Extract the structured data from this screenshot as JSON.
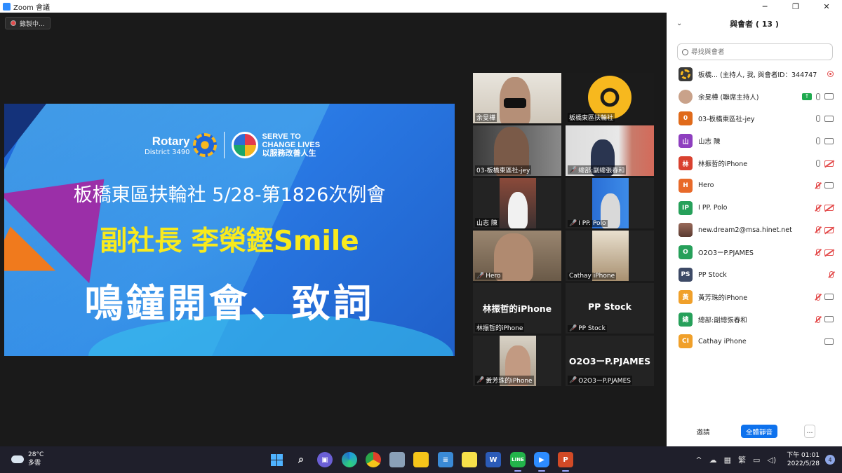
{
  "window": {
    "title": "Zoom 會議"
  },
  "recording": {
    "label": "錄製中..."
  },
  "slide": {
    "rotary": "Rotary",
    "district": "District 3490",
    "serve_line1": "SERVE TO",
    "serve_line2": "CHANGE LIVES",
    "serve_line3": "以服務改善人生",
    "line1": "板橋東區扶輪社   5/28-第1826次例會",
    "line2": "副社長 李榮鏗Smile",
    "line3": "鳴鐘開會、致詞"
  },
  "tiles": [
    {
      "name": "余旻樺",
      "muted": false,
      "active": true
    },
    {
      "name": "板橋東區扶輪社",
      "muted": false
    },
    {
      "name": "03-板橋東區社-jey",
      "muted": false
    },
    {
      "name": "總部:副總張春和",
      "muted": true
    },
    {
      "name": "山志 陳",
      "muted": false
    },
    {
      "name": "I PP.  Polo",
      "muted": true
    },
    {
      "name": "Hero",
      "muted": true
    },
    {
      "name": "Cathay iPhone",
      "muted": false
    },
    {
      "name": "林振哲的iPhone",
      "muted": false,
      "big": "林振哲的iPhone"
    },
    {
      "name": "PP Stock",
      "muted": true,
      "big": "PP Stock"
    },
    {
      "name": "黃芳珠的iPhone",
      "muted": true
    },
    {
      "name": "O2O3ーP.PJAMES",
      "muted": true,
      "big": "O2O3ーP.PJAMES"
    }
  ],
  "panel": {
    "title": "與會者 ( 13 )",
    "search_placeholder": "尋找與會者",
    "participants": [
      {
        "initial": "",
        "color": "#3a3a3a",
        "name": "板橋... (主持人, 我, 與會者ID：344747)",
        "mic": "",
        "cam": "",
        "rec": true
      },
      {
        "initial": "",
        "color": "#c9a28a",
        "name": "余旻樺 (聯席主持人)",
        "mic": "on",
        "cam": "on",
        "share": true
      },
      {
        "initial": "0",
        "color": "#e06a1a",
        "name": "03-板橋東區社-jey",
        "mic": "on",
        "cam": "on"
      },
      {
        "initial": "山",
        "color": "#8e3fbf",
        "name": "山志 陳",
        "mic": "on",
        "cam": "on"
      },
      {
        "initial": "林",
        "color": "#d9412f",
        "name": "林振哲的iPhone",
        "mic": "on",
        "cam": "off"
      },
      {
        "initial": "H",
        "color": "#e86a2a",
        "name": "Hero",
        "mic": "off",
        "cam": "on"
      },
      {
        "initial": "IP",
        "color": "#26a05a",
        "name": "I PP.  Polo",
        "mic": "off",
        "cam": "off"
      },
      {
        "initial": "",
        "color": "#9a6a5a",
        "name": "new.dream2@msa.hinet.net",
        "mic": "off",
        "cam": "off"
      },
      {
        "initial": "O",
        "color": "#26a05a",
        "name": "O2O3ーP.PJAMES",
        "mic": "off",
        "cam": "off"
      },
      {
        "initial": "PS",
        "color": "#3d4a66",
        "name": "PP Stock",
        "mic": "off",
        "cam": ""
      },
      {
        "initial": "黃",
        "color": "#f0a02a",
        "name": "黃芳珠的iPhone",
        "mic": "off",
        "cam": "on"
      },
      {
        "initial": "總",
        "color": "#26a05a",
        "name": "總部:副總張春和",
        "mic": "off",
        "cam": "on"
      },
      {
        "initial": "CI",
        "color": "#f0a02a",
        "name": "Cathay iPhone",
        "mic": "",
        "cam": "on"
      }
    ],
    "invite_label": "邀請",
    "mute_all_label": "全體靜音",
    "more_label": "..."
  },
  "taskbar": {
    "temp": "28°C",
    "weather": "多雲",
    "time": "下午 01:01",
    "date": "2022/5/28",
    "notifications": "4",
    "ime": "繁"
  }
}
